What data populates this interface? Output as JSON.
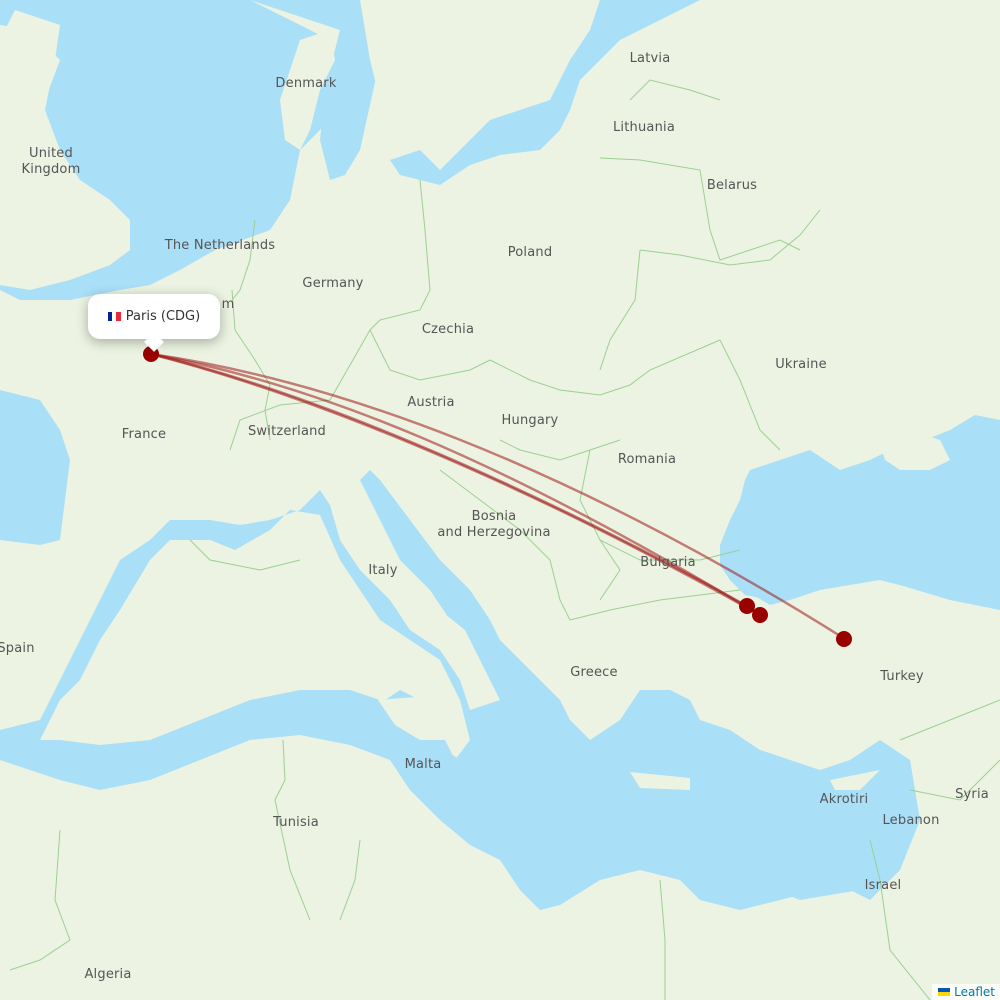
{
  "map": {
    "origin": {
      "name": "Paris (CDG)",
      "flag": "fr-flag",
      "flag_colors": [
        "#002395",
        "#ffffff",
        "#ed2939"
      ]
    },
    "labels": [
      {
        "id": "latvia",
        "text": "Latvia"
      },
      {
        "id": "denmark",
        "text": "Denmark"
      },
      {
        "id": "lithuania",
        "text": "Lithuania"
      },
      {
        "id": "uk",
        "text": "United\nKingdom"
      },
      {
        "id": "belarus",
        "text": "Belarus"
      },
      {
        "id": "netherlands",
        "text": "The Netherlands"
      },
      {
        "id": "poland",
        "text": "Poland"
      },
      {
        "id": "germany",
        "text": "Germany"
      },
      {
        "id": "czechia",
        "text": "Czechia"
      },
      {
        "id": "ukraine",
        "text": "Ukraine"
      },
      {
        "id": "austria",
        "text": "Austria"
      },
      {
        "id": "france",
        "text": "France"
      },
      {
        "id": "switzerland",
        "text": "Switzerland"
      },
      {
        "id": "hungary",
        "text": "Hungary"
      },
      {
        "id": "romania",
        "text": "Romania"
      },
      {
        "id": "bosnia",
        "text": "Bosnia\nand Herzegovina"
      },
      {
        "id": "italy",
        "text": "Italy"
      },
      {
        "id": "bulgaria",
        "text": "Bulgaria"
      },
      {
        "id": "spain",
        "text": "Spain"
      },
      {
        "id": "greece",
        "text": "Greece"
      },
      {
        "id": "turkey",
        "text": "Turkey"
      },
      {
        "id": "malta",
        "text": "Malta"
      },
      {
        "id": "akrotiri",
        "text": "Akrotiri"
      },
      {
        "id": "syria",
        "text": "Syria"
      },
      {
        "id": "tunisia",
        "text": "Tunisia"
      },
      {
        "id": "lebanon",
        "text": "Lebanon"
      },
      {
        "id": "israel",
        "text": "Israel"
      },
      {
        "id": "algeria",
        "text": "Algeria"
      },
      {
        "id": "belgium-partial",
        "text": "m"
      }
    ],
    "route_color": "#a01a1a",
    "airport_color": "#990000",
    "destinations_count": 3
  },
  "attribution": {
    "label": "Leaflet"
  }
}
